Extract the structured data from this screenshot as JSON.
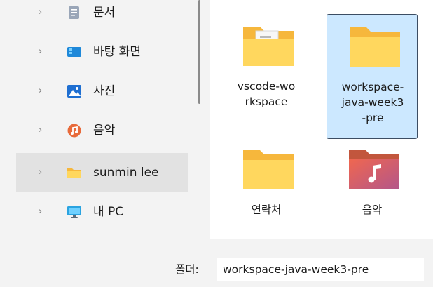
{
  "sidebar": {
    "items": [
      {
        "label": "문서",
        "icon": "documents-icon"
      },
      {
        "label": "바탕 화면",
        "icon": "desktop-icon"
      },
      {
        "label": "사진",
        "icon": "pictures-icon"
      },
      {
        "label": "음악",
        "icon": "music-icon"
      },
      {
        "label": "sunmin lee",
        "icon": "user-folder-icon",
        "selected": true
      },
      {
        "label": "내 PC",
        "icon": "this-pc-icon"
      }
    ]
  },
  "files": [
    {
      "name_line1": "vscode-wo",
      "name_line2": "rkspace",
      "name_line3": "",
      "icon": "folder-with-document-icon"
    },
    {
      "name_line1": "workspace-",
      "name_line2": "java-week3",
      "name_line3": "-pre",
      "icon": "folder-icon",
      "selected": true
    },
    {
      "name_line1": "연락처",
      "name_line2": "",
      "name_line3": "",
      "icon": "folder-icon"
    },
    {
      "name_line1": "음악",
      "name_line2": "",
      "name_line3": "",
      "icon": "music-folder-icon"
    }
  ],
  "footer": {
    "folder_label": "폴더:",
    "folder_value": "workspace-java-week3-pre"
  },
  "colors": {
    "selection": "#cce8ff",
    "sidebar_selected": "#e2e2e2",
    "folder_yellow": "#ffd75e",
    "folder_back": "#f6b73c"
  }
}
